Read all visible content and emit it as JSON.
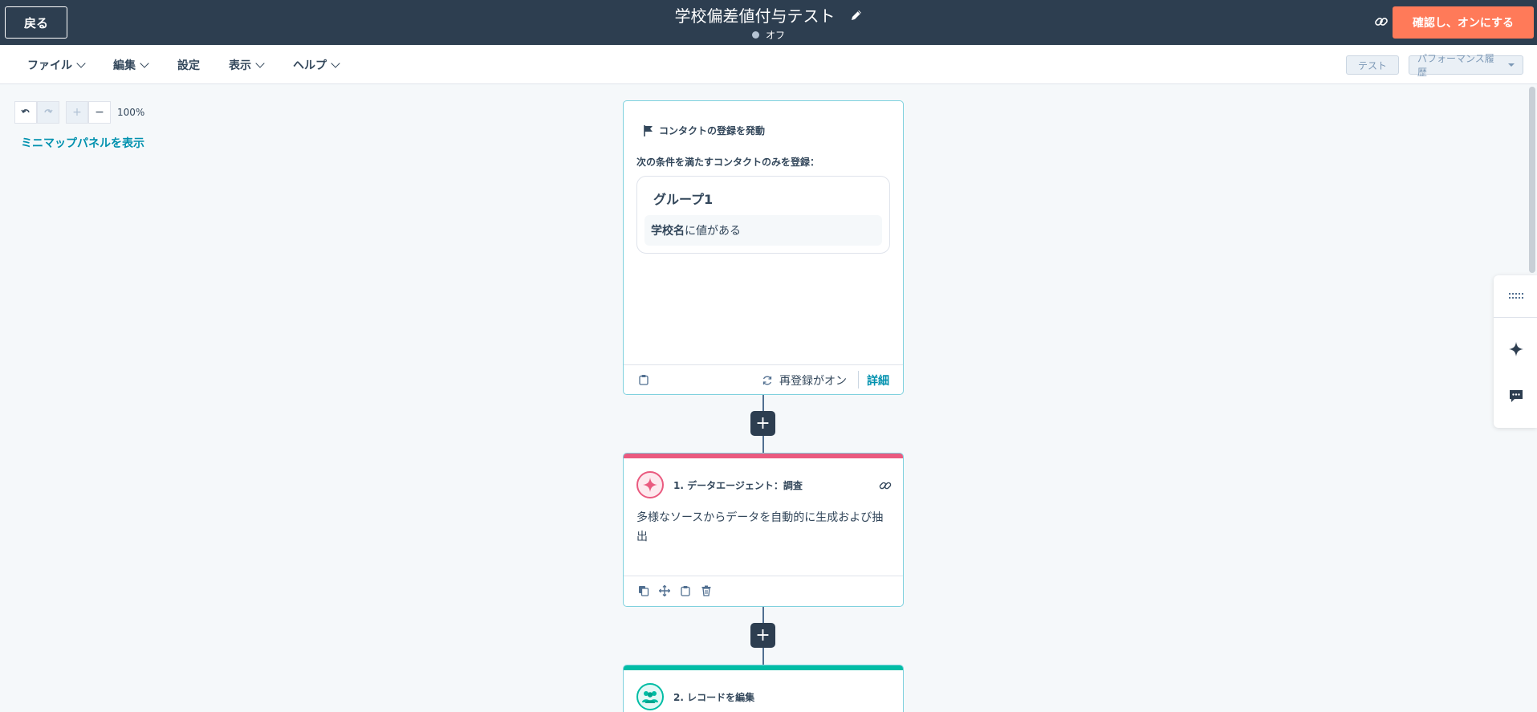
{
  "topbar": {
    "back_label": "戻る",
    "workflow_title": "学校偏差値付与テスト",
    "status": "オフ",
    "confirm_label": "確認し、オンにする"
  },
  "menu": {
    "items": [
      "ファイル",
      "編集",
      "設定",
      "表示",
      "ヘルプ"
    ],
    "test_label": "テスト",
    "performance_label": "パフォーマンス履歴"
  },
  "canvas": {
    "zoom_level": "100%",
    "minimap_label": "ミニマップパネルを表示"
  },
  "trigger": {
    "title": "コンタクトの登録を発動",
    "subtitle": "次の条件を満たすコンタクトのみを登録：",
    "group_title": "グループ1",
    "condition_property": "学校名",
    "condition_text": "に値がある",
    "reenroll_label": "再登録がオン",
    "details_label": "詳細"
  },
  "actions": [
    {
      "title": "1. データエージェント：調査",
      "description": "多様なソースからデータを自動的に生成および抽出",
      "accent_color": "#ea5a7f"
    },
    {
      "title": "2. レコードを編集",
      "accent_color": "#00bda5"
    }
  ],
  "colors": {
    "topbar": "#2d3e50",
    "primary_cta": "#ff7a59",
    "link": "#0091ae",
    "card_border": "#7fd1de"
  }
}
